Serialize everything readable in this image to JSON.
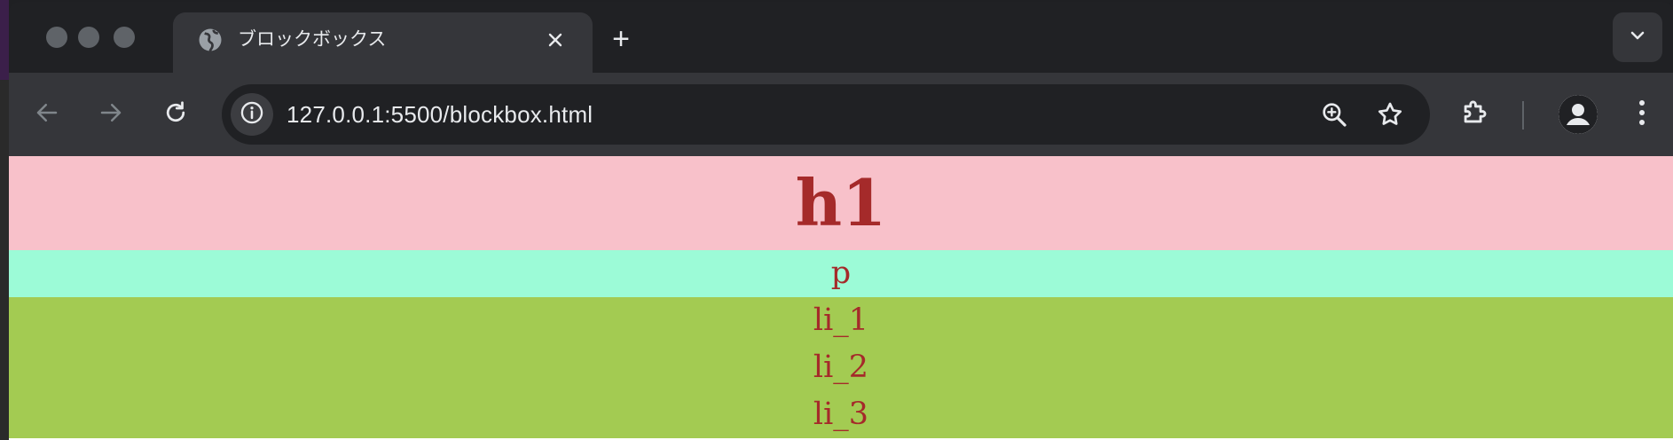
{
  "tab": {
    "title": "ブロックボックス",
    "icon": "globe-icon"
  },
  "tabstrip": {
    "new_tab_label": "+"
  },
  "toolbar": {
    "url": "127.0.0.1:5500/blockbox.html",
    "icons": [
      "back-icon",
      "forward-icon",
      "reload-icon",
      "site-info-icon",
      "zoom-icon",
      "star-icon",
      "extensions-icon",
      "profile-icon",
      "menu-icon"
    ]
  },
  "page": {
    "h1": "h1",
    "p": "p",
    "list_items": [
      "li_1",
      "li_2",
      "li_3"
    ]
  },
  "colors": {
    "h1_background": "#f8c1ca",
    "p_background": "#9cfbd7",
    "ul_background": "#a3cb52",
    "text": "#a52a2a"
  }
}
